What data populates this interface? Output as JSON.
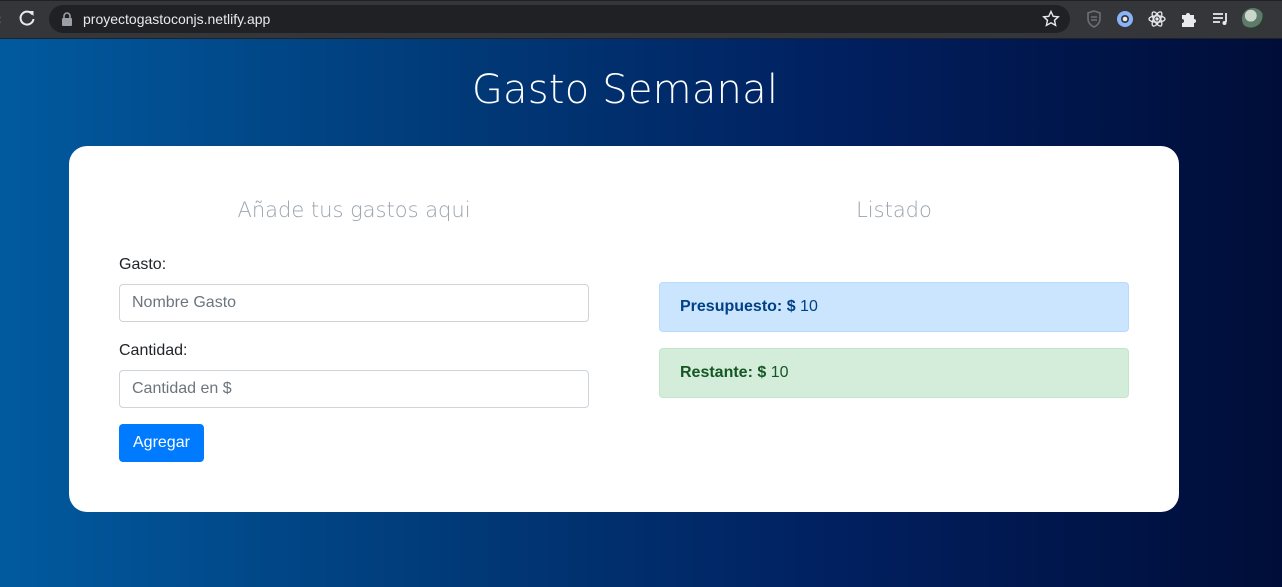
{
  "browser": {
    "url": "proyectogastoconjs.netlify.app",
    "icons": [
      "reload-icon",
      "lock-icon",
      "star-icon",
      "shield-icon",
      "extension-circle-icon",
      "react-icon",
      "puzzle-icon",
      "reading-list-icon",
      "avatar"
    ]
  },
  "app": {
    "title": "Gasto Semanal",
    "form": {
      "heading": "Añade tus gastos aqui",
      "gasto_label": "Gasto:",
      "gasto_placeholder": "Nombre Gasto",
      "cantidad_label": "Cantidad:",
      "cantidad_placeholder": "Cantidad en $",
      "submit_label": "Agregar"
    },
    "listado": {
      "heading": "Listado",
      "presupuesto_label": "Presupuesto: $",
      "presupuesto_value": "10",
      "restante_label": "Restante: $",
      "restante_value": "10"
    }
  },
  "colors": {
    "primary": "#007bff",
    "alert_primary_bg": "#cce5ff",
    "alert_success_bg": "#d4edda",
    "page_gradient_start": "#015a9f",
    "page_gradient_end": "#000d38"
  }
}
